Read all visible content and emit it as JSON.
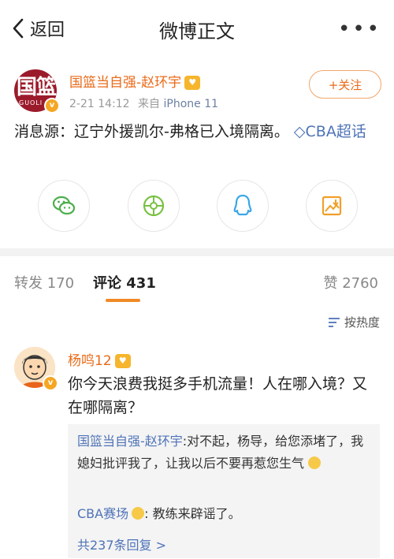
{
  "nav": {
    "back_label": "返回",
    "title": "微博正文",
    "more_label": "•••"
  },
  "post": {
    "author": "国篮当自强-赵环宇",
    "vip_badge": "♥",
    "avatar_text": "国篮",
    "avatar_sub": "GUOLI",
    "verified_badge": "v",
    "time": "2-21 14:12",
    "from_prefix": "来自",
    "device": "iPhone 11",
    "follow_label": "+关注",
    "text": "消息源：辽宁外援凯尔-弗格已入境隔离。",
    "topic_icon": "◇",
    "topic": "CBA超话",
    "share_icons": [
      "wechat-icon",
      "moments-icon",
      "qq-icon",
      "save-image-icon"
    ]
  },
  "tabs": {
    "repost_label": "转发",
    "repost_count": "170",
    "comment_label": "评论",
    "comment_count": "431",
    "like_label": "赞",
    "like_count": "2760"
  },
  "sort_label": "按热度",
  "comment": {
    "author": "杨鸣12",
    "vip_badge": "♥",
    "verified_badge": "v",
    "text": "你今天浪费我挺多手机流量！人在哪入境？又在哪隔离？",
    "replies": [
      {
        "user": "国篮当自强-赵环宇",
        "text": ":对不起，杨导，给您添堵了，我媳妇批评我了，让我以后不要再惹您生气"
      },
      {
        "user": "CBA赛场",
        "text": ": 教练来辟谣了。"
      }
    ],
    "more_replies": "共237条回复 >"
  },
  "colors": {
    "accent": "#ea6a18",
    "link": "#4e73b8",
    "tab_underline": "#f08a24"
  }
}
